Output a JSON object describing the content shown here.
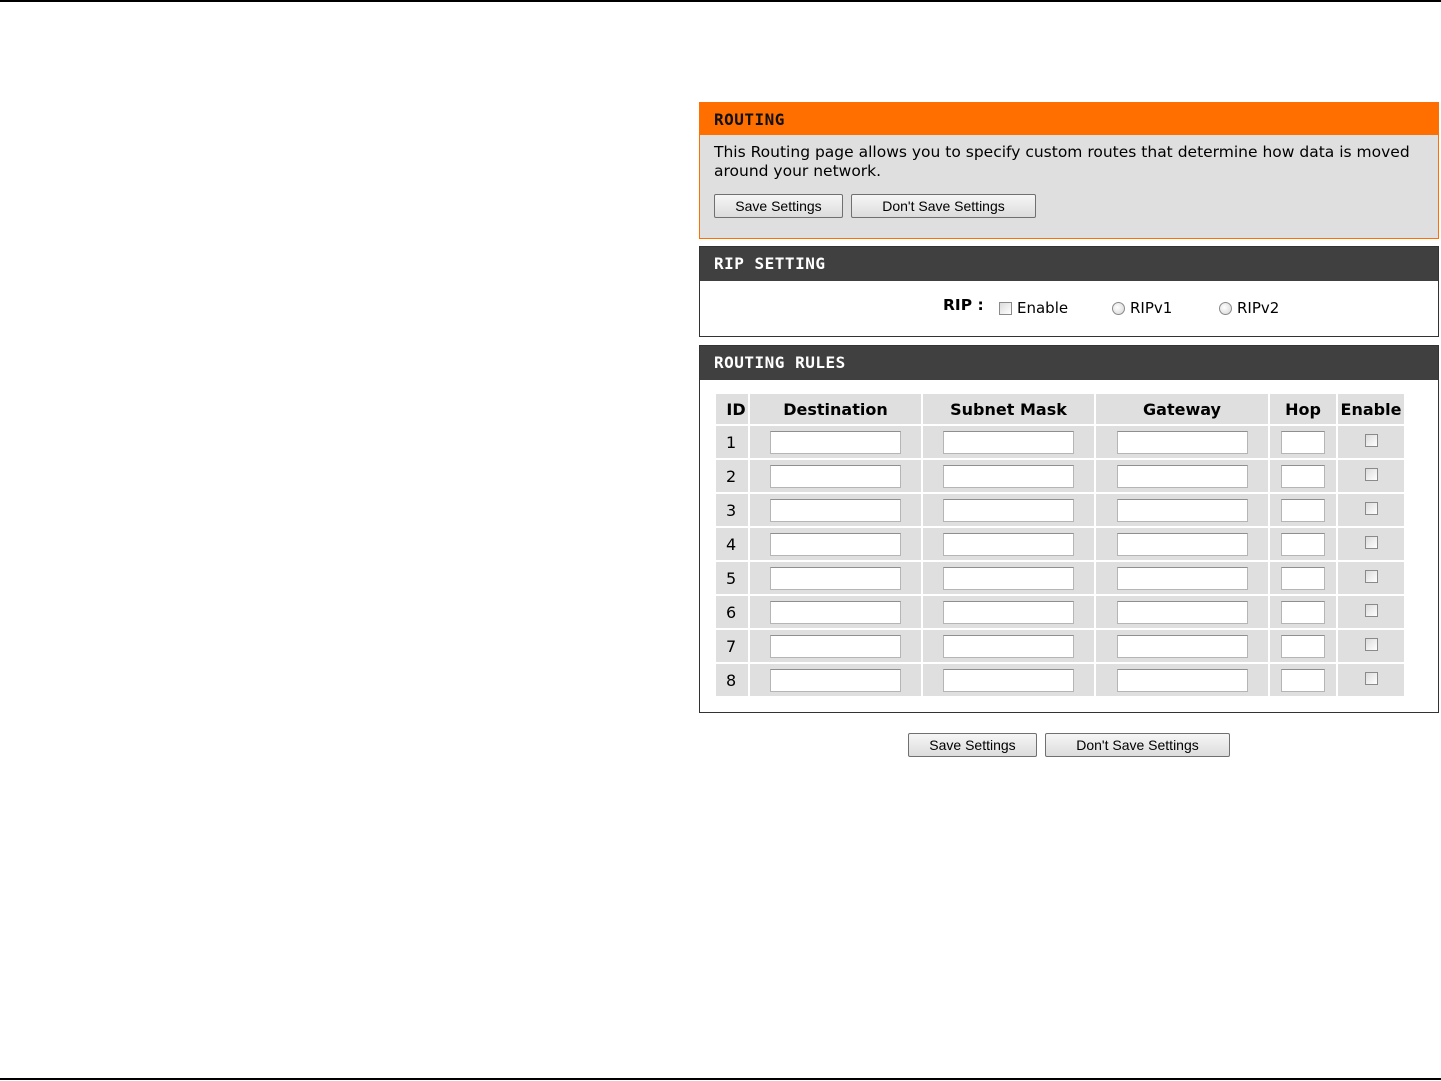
{
  "routing": {
    "title": "ROUTING",
    "description": "This Routing page allows you to specify custom routes that determine how data is moved around your network.",
    "save_label": "Save Settings",
    "dont_save_label": "Don't Save Settings"
  },
  "rip": {
    "title": "RIP SETTING",
    "label": "RIP :",
    "enable_label": "Enable",
    "ripv1_label": "RIPv1",
    "ripv2_label": "RIPv2"
  },
  "rules": {
    "title": "ROUTING RULES",
    "headers": {
      "id": "ID",
      "destination": "Destination",
      "subnet": "Subnet Mask",
      "gateway": "Gateway",
      "hop": "Hop",
      "enable": "Enable"
    },
    "rows": [
      {
        "id": "1",
        "destination": "",
        "subnet": "",
        "gateway": "",
        "hop": "",
        "enabled": false
      },
      {
        "id": "2",
        "destination": "",
        "subnet": "",
        "gateway": "",
        "hop": "",
        "enabled": false
      },
      {
        "id": "3",
        "destination": "",
        "subnet": "",
        "gateway": "",
        "hop": "",
        "enabled": false
      },
      {
        "id": "4",
        "destination": "",
        "subnet": "",
        "gateway": "",
        "hop": "",
        "enabled": false
      },
      {
        "id": "5",
        "destination": "",
        "subnet": "",
        "gateway": "",
        "hop": "",
        "enabled": false
      },
      {
        "id": "6",
        "destination": "",
        "subnet": "",
        "gateway": "",
        "hop": "",
        "enabled": false
      },
      {
        "id": "7",
        "destination": "",
        "subnet": "",
        "gateway": "",
        "hop": "",
        "enabled": false
      },
      {
        "id": "8",
        "destination": "",
        "subnet": "",
        "gateway": "",
        "hop": "",
        "enabled": false
      }
    ]
  },
  "footer": {
    "save_label": "Save Settings",
    "dont_save_label": "Don't Save Settings"
  },
  "colors": {
    "accent": "#ff6f00",
    "header_dark": "#404040",
    "panel_gray": "#dfdfdf"
  }
}
